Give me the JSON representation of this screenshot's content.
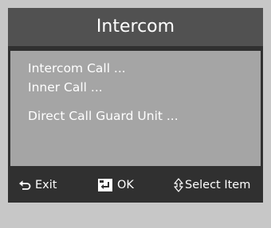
{
  "window": {
    "title": "Intercom"
  },
  "menu": {
    "items": [
      {
        "label": "Intercom Call ..."
      },
      {
        "label": "Inner Call ..."
      },
      {
        "label": "Direct Call Guard Unit ..."
      }
    ]
  },
  "footer": {
    "exit": {
      "label": "Exit",
      "icon": "back-arrow-icon"
    },
    "ok": {
      "label": "OK",
      "icon": "enter-key-icon"
    },
    "select": {
      "label": "Select Item",
      "icon": "up-down-arrow-icon"
    }
  },
  "colors": {
    "background": "#c7c7c7",
    "panel": "#303030",
    "title_bar": "#515151",
    "menu_area": "#a5a5a5",
    "text": "#ffffff"
  }
}
